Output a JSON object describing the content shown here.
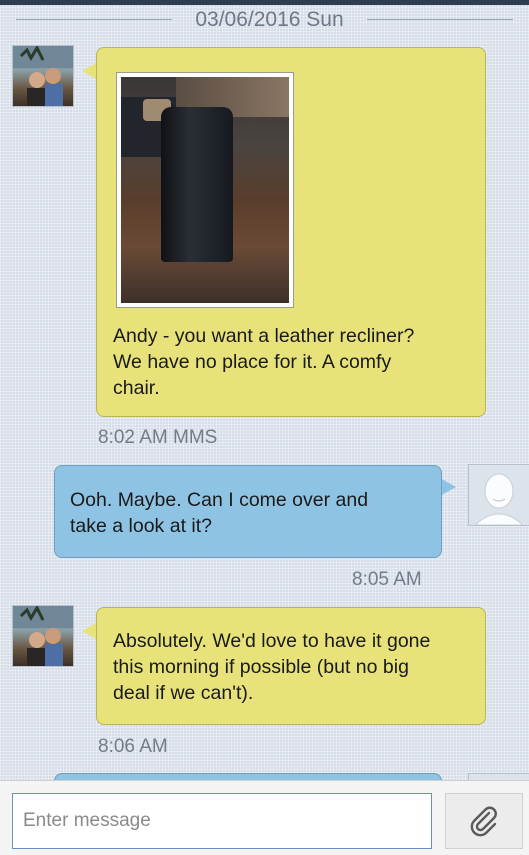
{
  "date_separator": "03/06/2016 Sun",
  "messages": [
    {
      "direction": "incoming",
      "has_image": true,
      "text_lines": [
        "Andy - you want a leather recliner?",
        "We have no place for it. A comfy",
        "chair."
      ],
      "meta": "8:02 AM MMS"
    },
    {
      "direction": "outgoing",
      "text_lines": [
        "Ooh. Maybe. Can I come over and",
        "take a look at it?"
      ],
      "meta": "8:05 AM"
    },
    {
      "direction": "incoming",
      "text_lines": [
        "Absolutely. We'd love to have it gone",
        "this morning if possible (but no big",
        "deal if we can't)."
      ],
      "meta": "8:06 AM"
    }
  ],
  "composer": {
    "placeholder": "Enter message",
    "value": "",
    "attach_icon": "paperclip-icon"
  },
  "colors": {
    "incoming_bubble": "#e8e27b",
    "outgoing_bubble": "#8fc3e3",
    "top_bar": "#2f3d52"
  }
}
